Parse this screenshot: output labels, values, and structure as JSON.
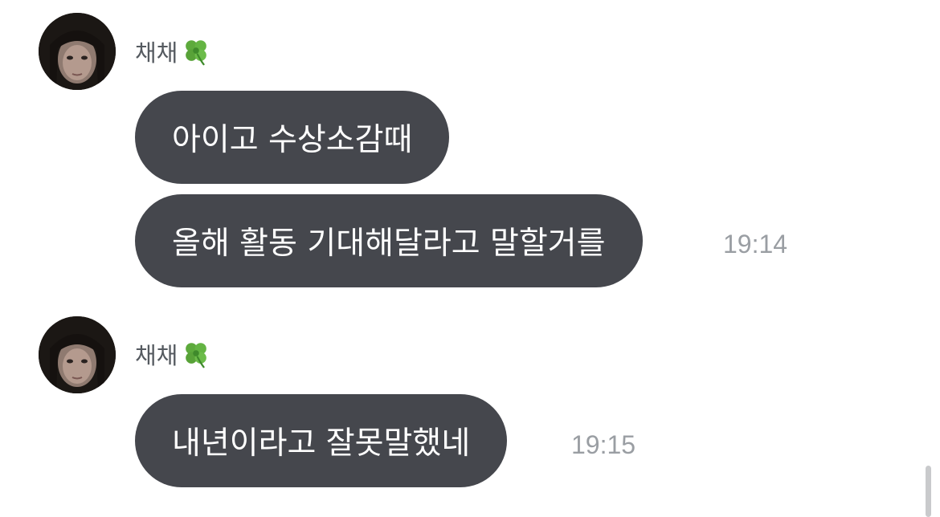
{
  "groups": [
    {
      "sender": "채채",
      "sender_icon": "four-leaf-clover-icon",
      "messages": [
        {
          "text": "아이고 수상소감때",
          "time": ""
        },
        {
          "text": "올해 활동 기대해달라고 말할거를",
          "time": "19:14"
        }
      ]
    },
    {
      "sender": "채채",
      "sender_icon": "four-leaf-clover-icon",
      "messages": [
        {
          "text": "내년이라고 잘못말했네",
          "time": "19:15"
        }
      ]
    }
  ],
  "colors": {
    "bubble": "#45474d",
    "bubble_text": "#ffffff",
    "sender_text": "#555a60",
    "time_text": "#9a9ea3",
    "background": "#ffffff"
  }
}
